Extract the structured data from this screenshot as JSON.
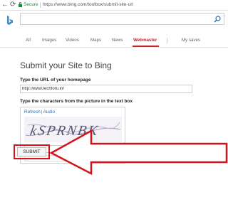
{
  "browser": {
    "secure_label": "Secure",
    "url": "https://www.bing.com/toolbox/submit-site-url",
    "icons": [
      "back-arrow-icon",
      "refresh-icon",
      "lock-icon"
    ]
  },
  "header": {
    "logo": "bing-logo",
    "search_placeholder": "",
    "tabs": [
      {
        "label": "All"
      },
      {
        "label": "Images"
      },
      {
        "label": "Videos"
      },
      {
        "label": "Maps"
      },
      {
        "label": "News"
      },
      {
        "label": "Webmaster",
        "active": true
      },
      {
        "label": "My saves"
      }
    ]
  },
  "main": {
    "title": "Submit your Site to Bing",
    "url_label": "Type the URL of your homepage",
    "url_value": "http://www.techforu.in/",
    "captcha_label": "Type the characters from the picture in the text box",
    "refresh_link": "Refresh",
    "audio_link": "Audio",
    "captcha_text": "kSPRNBK",
    "submit_label": "SUBMIT"
  },
  "annotation": {
    "color": "#d2141a"
  }
}
